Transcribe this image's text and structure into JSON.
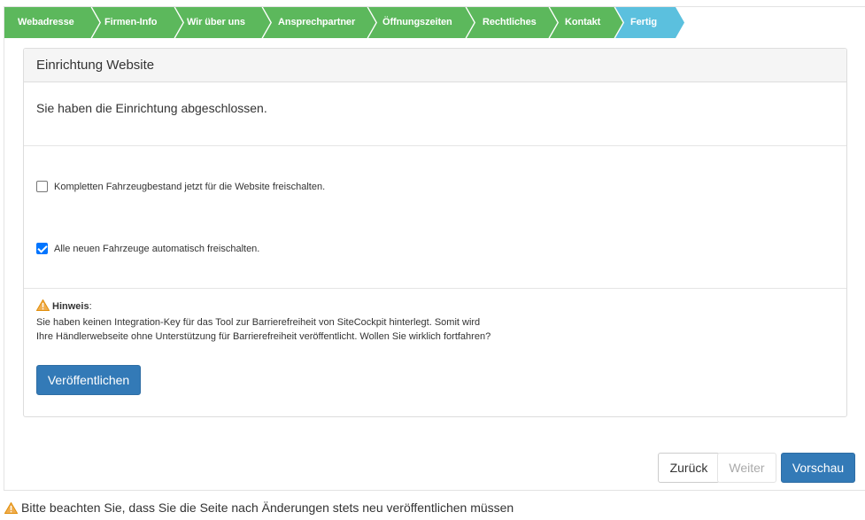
{
  "wizard": {
    "steps": [
      {
        "label": "Webadresse",
        "state": "done"
      },
      {
        "label": "Firmen-Info",
        "state": "done"
      },
      {
        "label": "Wir über uns",
        "state": "done"
      },
      {
        "label": "Ansprechpartner",
        "state": "done"
      },
      {
        "label": "Öffnungszeiten",
        "state": "done"
      },
      {
        "label": "Rechtliches",
        "state": "done"
      },
      {
        "label": "Kontakt",
        "state": "done"
      },
      {
        "label": "Fertig",
        "state": "active"
      }
    ],
    "colors": {
      "done": "#5cb85c",
      "active": "#5bc0de"
    }
  },
  "panel": {
    "title": "Einrichtung Website",
    "done_text": "Sie haben die Einrichtung abgeschlossen.",
    "options": [
      {
        "label": "Kompletten Fahrzeugbestand jetzt für die Website freischalten.",
        "checked": false
      },
      {
        "label": "Alle neuen Fahrzeuge automatisch freischalten.",
        "checked": true
      }
    ],
    "hint": {
      "title": "Hinweis",
      "colon": ":",
      "text": "Sie haben keinen Integration-Key für das Tool zur Barrierefreiheit von SiteCockpit hinterlegt. Somit wird Ihre Händlerwebseite ohne Unterstützung für Barrierefreiheit veröffentlicht. Wollen Sie wirklich fortfahren?"
    },
    "publish_label": "Veröffentlichen"
  },
  "nav": {
    "back_label": "Zurück",
    "next_label": "Weiter",
    "preview_label": "Vorschau"
  },
  "footer_note": "Bitte beachten Sie, dass Sie die Seite nach Änderungen stets neu veröffentlichen müssen"
}
